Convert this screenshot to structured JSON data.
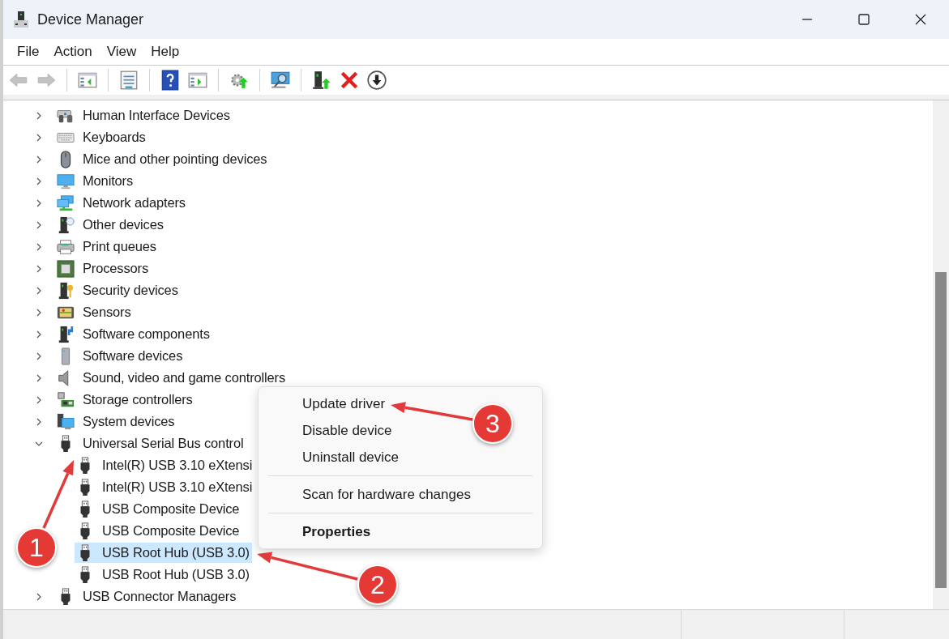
{
  "window": {
    "title": "Device Manager"
  },
  "menu": [
    "File",
    "Action",
    "View",
    "Help"
  ],
  "toolbar": [
    [
      {
        "kind": "back",
        "disabled": true
      },
      {
        "kind": "forward",
        "disabled": true
      }
    ],
    [
      {
        "kind": "console-tree",
        "disabled": false
      }
    ],
    [
      {
        "kind": "properties",
        "disabled": false
      }
    ],
    [
      {
        "kind": "help",
        "disabled": false
      },
      {
        "kind": "action-pane",
        "disabled": false
      }
    ],
    [
      {
        "kind": "update-driver",
        "disabled": false
      }
    ],
    [
      {
        "kind": "scan",
        "disabled": false
      }
    ],
    [
      {
        "kind": "add-driver",
        "disabled": false
      },
      {
        "kind": "uninstall",
        "disabled": false
      },
      {
        "kind": "disable",
        "disabled": false
      }
    ]
  ],
  "tree": [
    {
      "label": "Human Interface Devices",
      "kind": "hid",
      "expanded": false,
      "selected": false
    },
    {
      "label": "Keyboards",
      "kind": "keyboard",
      "expanded": false,
      "selected": false
    },
    {
      "label": "Mice and other pointing devices",
      "kind": "mouse",
      "expanded": false,
      "selected": false
    },
    {
      "label": "Monitors",
      "kind": "monitor",
      "expanded": false,
      "selected": false
    },
    {
      "label": "Network adapters",
      "kind": "network",
      "expanded": false,
      "selected": false
    },
    {
      "label": "Other devices",
      "kind": "other",
      "expanded": false,
      "selected": false
    },
    {
      "label": "Print queues",
      "kind": "printer",
      "expanded": false,
      "selected": false
    },
    {
      "label": "Processors",
      "kind": "processor",
      "expanded": false,
      "selected": false
    },
    {
      "label": "Security devices",
      "kind": "security",
      "expanded": false,
      "selected": false
    },
    {
      "label": "Sensors",
      "kind": "sensor",
      "expanded": false,
      "selected": false
    },
    {
      "label": "Software components",
      "kind": "swcomp",
      "expanded": false,
      "selected": false
    },
    {
      "label": "Software devices",
      "kind": "swdev",
      "expanded": false,
      "selected": false
    },
    {
      "label": "Sound, video and game controllers",
      "kind": "sound",
      "expanded": false,
      "selected": false
    },
    {
      "label": "Storage controllers",
      "kind": "storage",
      "expanded": false,
      "selected": false
    },
    {
      "label": "System devices",
      "kind": "system",
      "expanded": false,
      "selected": false
    },
    {
      "label": "Universal Serial Bus control",
      "kind": "usb",
      "expanded": true,
      "selected": false,
      "children": [
        {
          "label": "Intel(R) USB 3.10 eXtensi",
          "kind": "usb",
          "selected": false
        },
        {
          "label": "Intel(R) USB 3.10 eXtensi",
          "kind": "usb",
          "selected": false
        },
        {
          "label": "USB Composite Device",
          "kind": "usb",
          "selected": false
        },
        {
          "label": "USB Composite Device",
          "kind": "usb",
          "selected": false
        },
        {
          "label": "USB Root Hub (USB 3.0)",
          "kind": "usb",
          "selected": true
        },
        {
          "label": "USB Root Hub (USB 3.0)",
          "kind": "usb",
          "selected": false
        }
      ]
    },
    {
      "label": "USB Connector Managers",
      "kind": "usb",
      "expanded": false,
      "selected": false
    }
  ],
  "context_menu": [
    [
      {
        "label": "Update driver",
        "default": false
      },
      {
        "label": "Disable device",
        "default": false
      },
      {
        "label": "Uninstall device",
        "default": false
      }
    ],
    [
      {
        "label": "Scan for hardware changes",
        "default": false
      }
    ],
    [
      {
        "label": "Properties",
        "default": true
      }
    ]
  ],
  "annotations": [
    {
      "number": "1"
    },
    {
      "number": "2"
    },
    {
      "number": "3"
    }
  ]
}
